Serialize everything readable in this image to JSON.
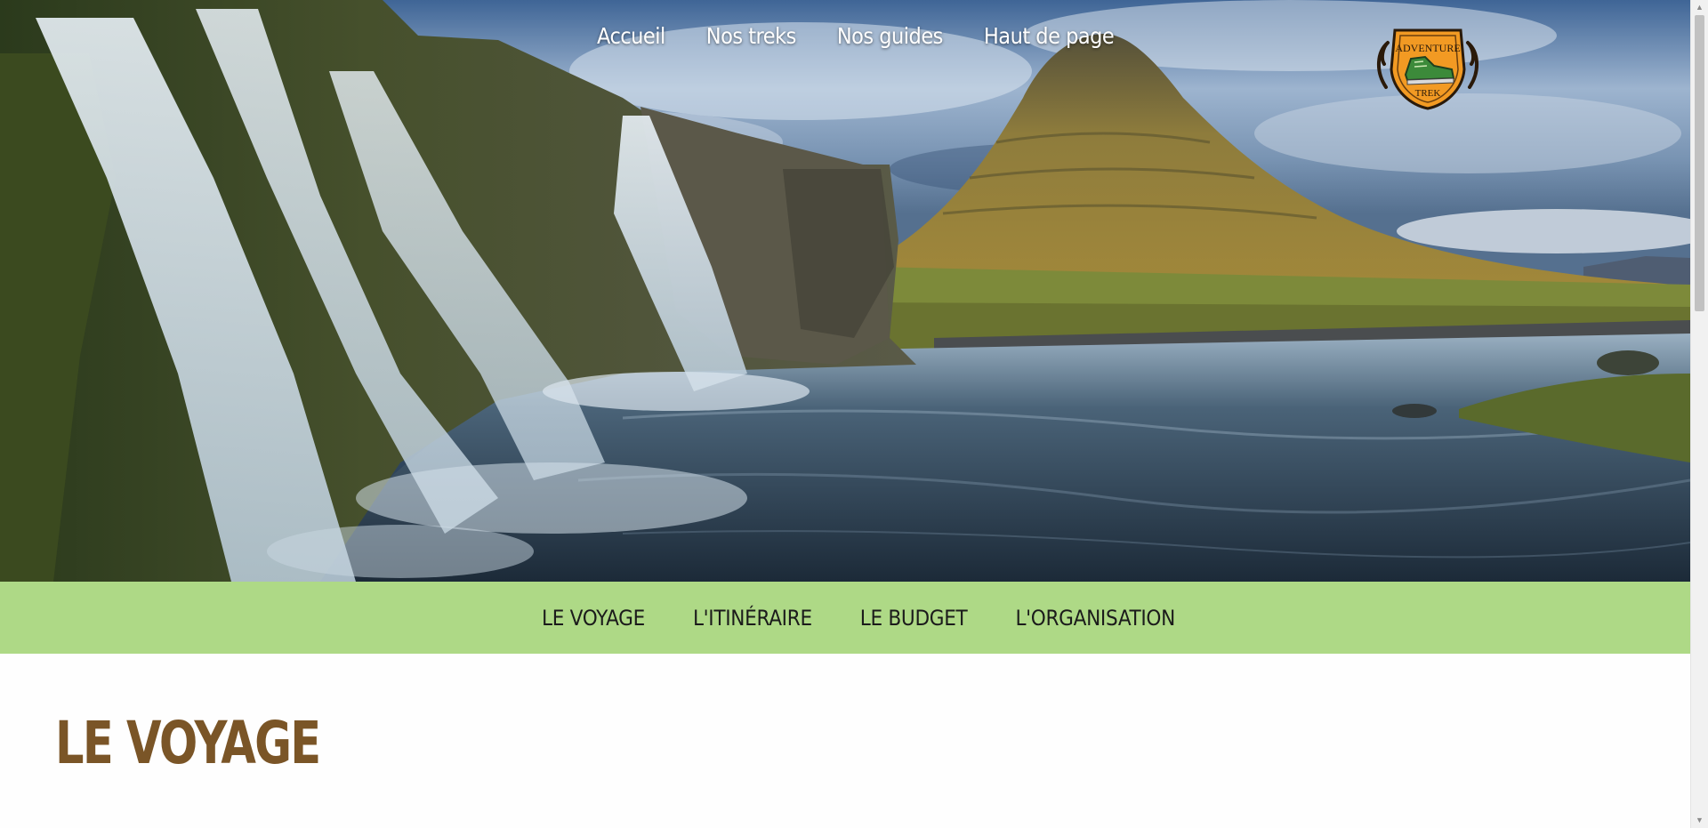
{
  "top_nav": {
    "items": [
      {
        "label": "Accueil"
      },
      {
        "label": "Nos treks"
      },
      {
        "label": "Nos guides"
      },
      {
        "label": "Haut de page"
      }
    ]
  },
  "logo": {
    "line1": "ADVENTURE",
    "line2": "TREK"
  },
  "sub_nav": {
    "items": [
      {
        "label": "LE VOYAGE"
      },
      {
        "label": "L'ITINÉRAIRE"
      },
      {
        "label": "LE BUDGET"
      },
      {
        "label": "L'ORGANISATION"
      }
    ]
  },
  "main": {
    "section_title": "LE VOYAGE"
  },
  "colors": {
    "sub_nav_bg": "#aed986",
    "title_color": "#7a5527",
    "logo_orange": "#f29a23"
  },
  "scrollbar": {
    "up_icon": "arrow-up-icon",
    "down_icon": "arrow-down-icon"
  }
}
